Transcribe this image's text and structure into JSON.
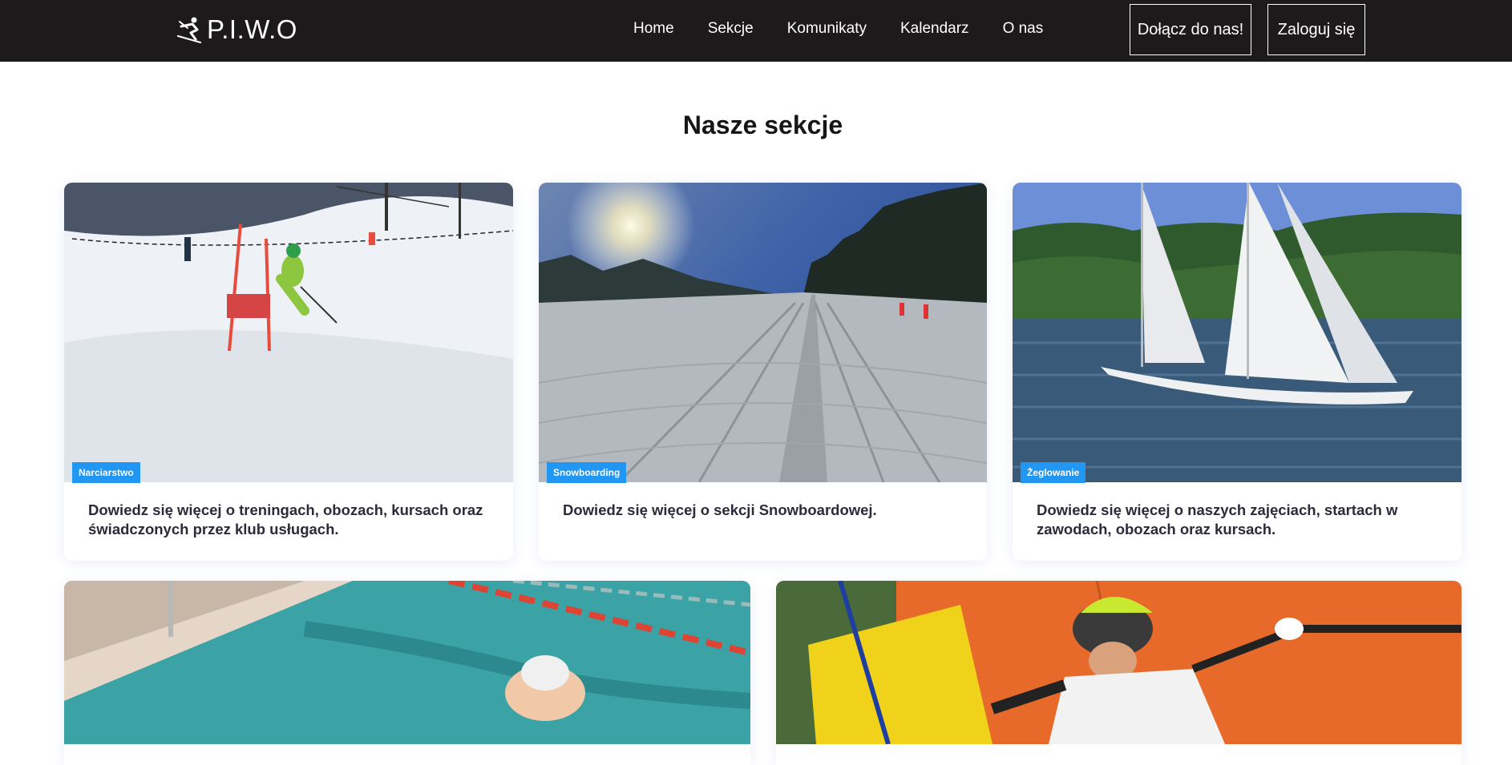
{
  "header": {
    "logo_text": "P.I.W.O",
    "nav": [
      "Home",
      "Sekcje",
      "Komunikaty",
      "Kalendarz",
      "O nas"
    ],
    "join_label": "Dołącz do nas!",
    "login_label": "Zaloguj się"
  },
  "main": {
    "title": "Nasze sekcje",
    "cards": [
      {
        "tag": "Narciarstwo",
        "text": "Dowiedz się więcej o treningach, obozach, kursach oraz świadczonych przez klub usługach."
      },
      {
        "tag": "Snowboarding",
        "text": "Dowiedz się więcej o sekcji Snowboardowej."
      },
      {
        "tag": "Żeglowanie",
        "text": "Dowiedz się więcej o naszych zajęciach, startach w zawodach, obozach oraz kursach."
      }
    ]
  },
  "colors": {
    "navbar": "#1c1a1a",
    "tag": "#2196f3",
    "title": "#161616"
  }
}
